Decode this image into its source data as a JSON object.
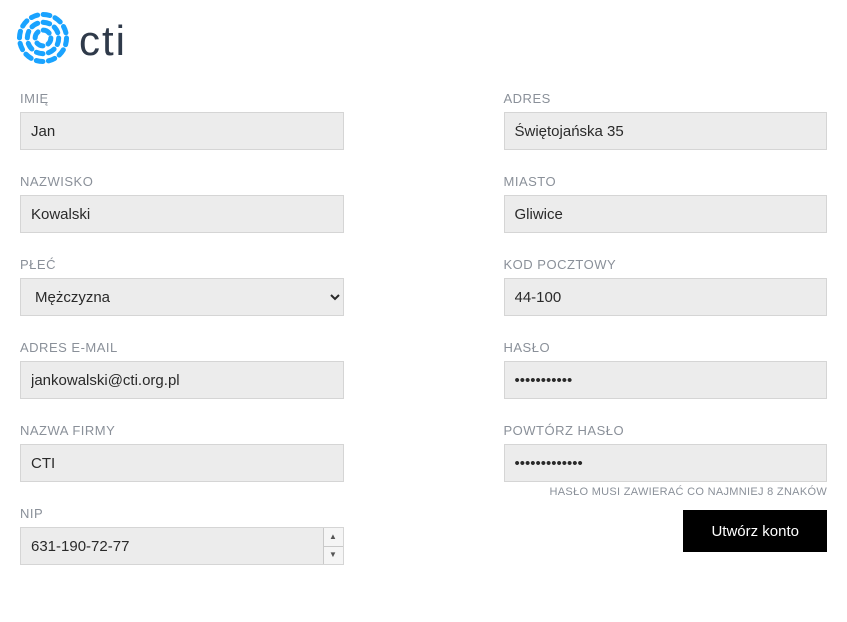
{
  "logo": {
    "text": "cti"
  },
  "left": {
    "first_name": {
      "label": "IMIĘ",
      "value": "Jan"
    },
    "last_name": {
      "label": "NAZWISKO",
      "value": "Kowalski"
    },
    "gender": {
      "label": "PŁEĆ",
      "value": "Mężczyzna"
    },
    "email": {
      "label": "ADRES E-MAIL",
      "value": "jankowalski@cti.org.pl"
    },
    "company": {
      "label": "NAZWA FIRMY",
      "value": "CTI"
    },
    "nip": {
      "label": "NIP",
      "value": "631-190-72-77"
    }
  },
  "right": {
    "address": {
      "label": "ADRES",
      "value": "Świętojańska 35"
    },
    "city": {
      "label": "MIASTO",
      "value": "Gliwice"
    },
    "postal": {
      "label": "KOD POCZTOWY",
      "value": "44-100"
    },
    "password": {
      "label": "HASŁO",
      "value": "password123"
    },
    "password_repeat": {
      "label": "POWTÓRZ HASŁO",
      "value": "password12345",
      "hint": "HASŁO MUSI ZAWIERAĆ CO NAJMNIEJ 8 ZNAKÓW"
    }
  },
  "submit": {
    "label": "Utwórz konto"
  }
}
